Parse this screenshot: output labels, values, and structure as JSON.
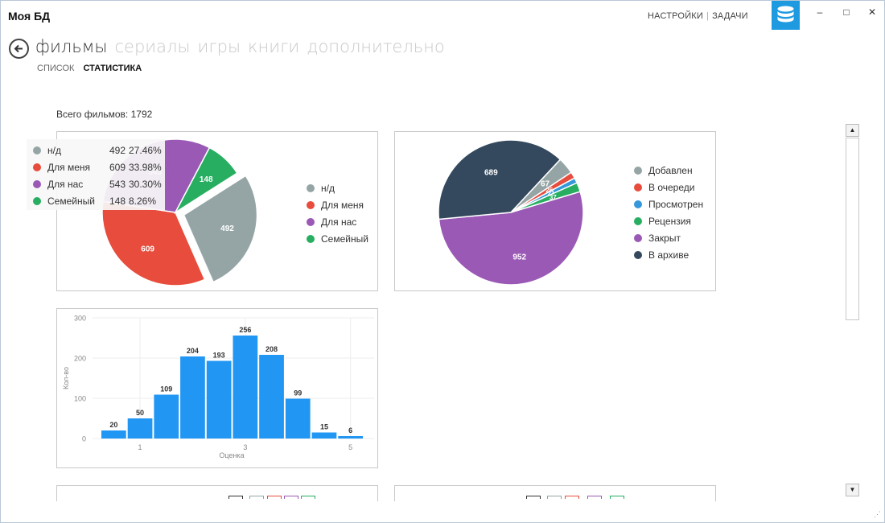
{
  "app": {
    "title": "Моя БД"
  },
  "top_links": {
    "settings": "НАСТРОЙКИ",
    "separator": "|",
    "tasks": "ЗАДАЧИ"
  },
  "window_controls": {
    "minimize": "–",
    "maximize": "□",
    "close": "✕"
  },
  "nav": {
    "tabs": [
      {
        "label": "фильмы",
        "active": true
      },
      {
        "label": "сериалы",
        "active": false
      },
      {
        "label": "игры",
        "active": false
      },
      {
        "label": "книги",
        "active": false
      },
      {
        "label": "дополнительно",
        "active": false
      }
    ],
    "subtabs": [
      {
        "label": "СПИСОК",
        "active": false
      },
      {
        "label": "СТАТИСТИКА",
        "active": true
      }
    ]
  },
  "total_label": "Всего фильмов: 1792",
  "colors": {
    "gray": "#95a5a6",
    "red": "#e74c3c",
    "purple": "#9b59b6",
    "green": "#27ae60",
    "blue": "#3498db",
    "navy": "#34495e",
    "bar": "#2196f3",
    "accent": "#1e9ae0"
  },
  "chart_data": [
    {
      "type": "pie",
      "title": "",
      "slices": [
        {
          "label": "н/д",
          "value": 492,
          "percent": "27.46%",
          "color": "#95a5a6"
        },
        {
          "label": "Для меня",
          "value": 609,
          "percent": "33.98%",
          "color": "#e74c3c"
        },
        {
          "label": "Для нас",
          "value": 543,
          "percent": "30.30%",
          "color": "#9b59b6"
        },
        {
          "label": "Семейный",
          "value": 148,
          "percent": "8.26%",
          "color": "#27ae60"
        }
      ],
      "legend_position": "right"
    },
    {
      "type": "pie",
      "title": "",
      "slices": [
        {
          "label": "Добавлен",
          "value": 67,
          "color": "#95a5a6"
        },
        {
          "label": "В очереди",
          "value": 26,
          "color": "#e74c3c"
        },
        {
          "label": "Просмотрен",
          "value": 21,
          "color": "#3498db"
        },
        {
          "label": "Рецензия",
          "value": 37,
          "color": "#27ae60"
        },
        {
          "label": "Закрыт",
          "value": 952,
          "color": "#9b59b6"
        },
        {
          "label": "В архиве",
          "value": 689,
          "color": "#34495e"
        }
      ],
      "legend_position": "right"
    },
    {
      "type": "bar",
      "title": "",
      "xlabel": "Оценка",
      "ylabel": "Кол-во",
      "x": [
        0.5,
        1,
        1.5,
        2,
        2.5,
        3,
        3.5,
        4,
        4.5,
        5
      ],
      "values": [
        20,
        50,
        109,
        204,
        193,
        256,
        208,
        99,
        15,
        6
      ],
      "ylim": [
        0,
        300
      ],
      "yticks": [
        "0",
        "100",
        "200",
        "300"
      ],
      "xticks": [
        "1",
        "3",
        "5"
      ],
      "grid": true
    }
  ],
  "tooltip": {
    "rows": [
      {
        "label": "н/д",
        "value": "492",
        "percent": "27.46%",
        "color": "#95a5a6"
      },
      {
        "label": "Для меня",
        "value": "609",
        "percent": "33.98%",
        "color": "#e74c3c"
      },
      {
        "label": "Для нас",
        "value": "543",
        "percent": "30.30%",
        "color": "#9b59b6"
      },
      {
        "label": "Семейный",
        "value": "148",
        "percent": "8.26%",
        "color": "#27ae60"
      }
    ]
  }
}
